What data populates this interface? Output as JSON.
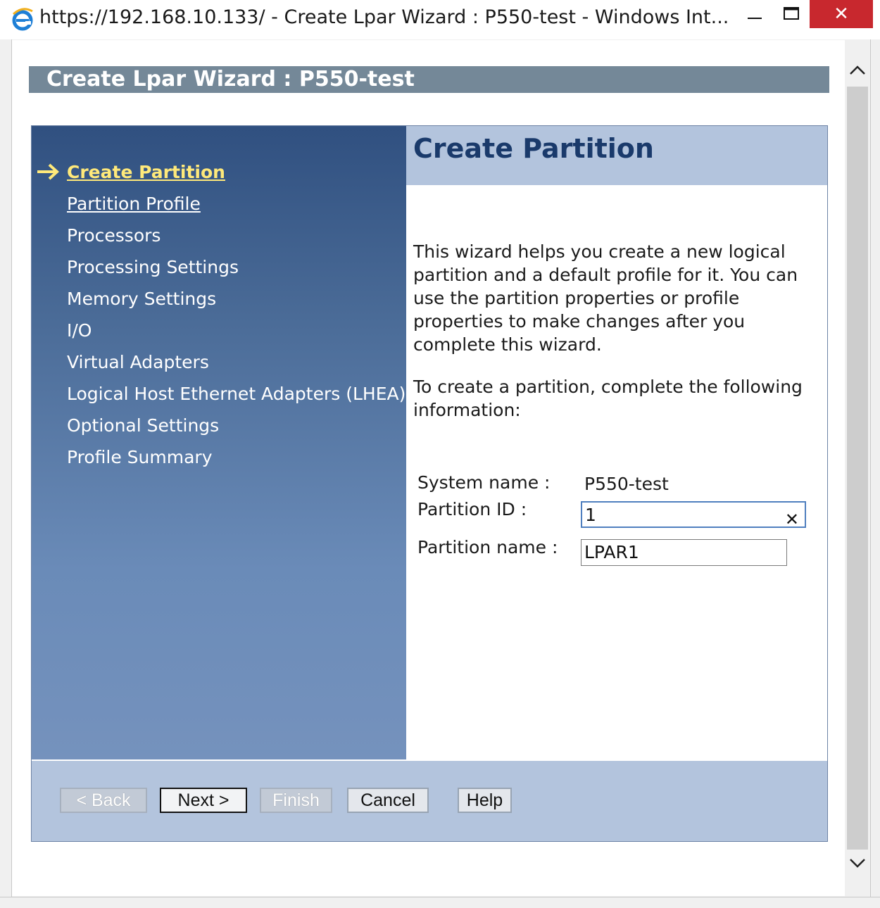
{
  "window": {
    "title": "https://192.168.10.133/ - Create Lpar Wizard : P550-test - Windows Int...",
    "controls": {
      "minimize": "—",
      "maximize": "□",
      "close": "✕"
    }
  },
  "wizard": {
    "header": "Create Lpar Wizard : P550-test",
    "nav": [
      {
        "label": "Create Partition",
        "state": "current"
      },
      {
        "label": "Partition Profile",
        "state": "link"
      },
      {
        "label": "Processors",
        "state": "normal"
      },
      {
        "label": "Processing Settings",
        "state": "normal"
      },
      {
        "label": "Memory Settings",
        "state": "normal"
      },
      {
        "label": "I/O",
        "state": "normal"
      },
      {
        "label": "Virtual Adapters",
        "state": "normal"
      },
      {
        "label": "Logical Host Ethernet Adapters (LHEA)",
        "state": "normal"
      },
      {
        "label": "Optional Settings",
        "state": "normal"
      },
      {
        "label": "Profile Summary",
        "state": "normal"
      }
    ],
    "panel": {
      "title": "Create Partition",
      "intro": " This wizard helps you create a new logical partition and a default profile for it. You can use the partition properties or profile properties to make changes after you complete this wizard.",
      "instruction": " To create a partition, complete the following information:",
      "system_name_label": "System name :",
      "system_name_value": "P550-test",
      "partition_id_label": "Partition ID :",
      "partition_id_value": "1",
      "partition_name_label": "Partition name :",
      "partition_name_value": "LPAR1"
    },
    "buttons": {
      "back": "< Back",
      "next": "Next >",
      "finish": "Finish",
      "cancel": "Cancel",
      "help": "Help"
    }
  },
  "colors": {
    "accent_current": "#ffe97a",
    "close_button": "#c8282e",
    "panel_title": "#1a3a6b"
  }
}
